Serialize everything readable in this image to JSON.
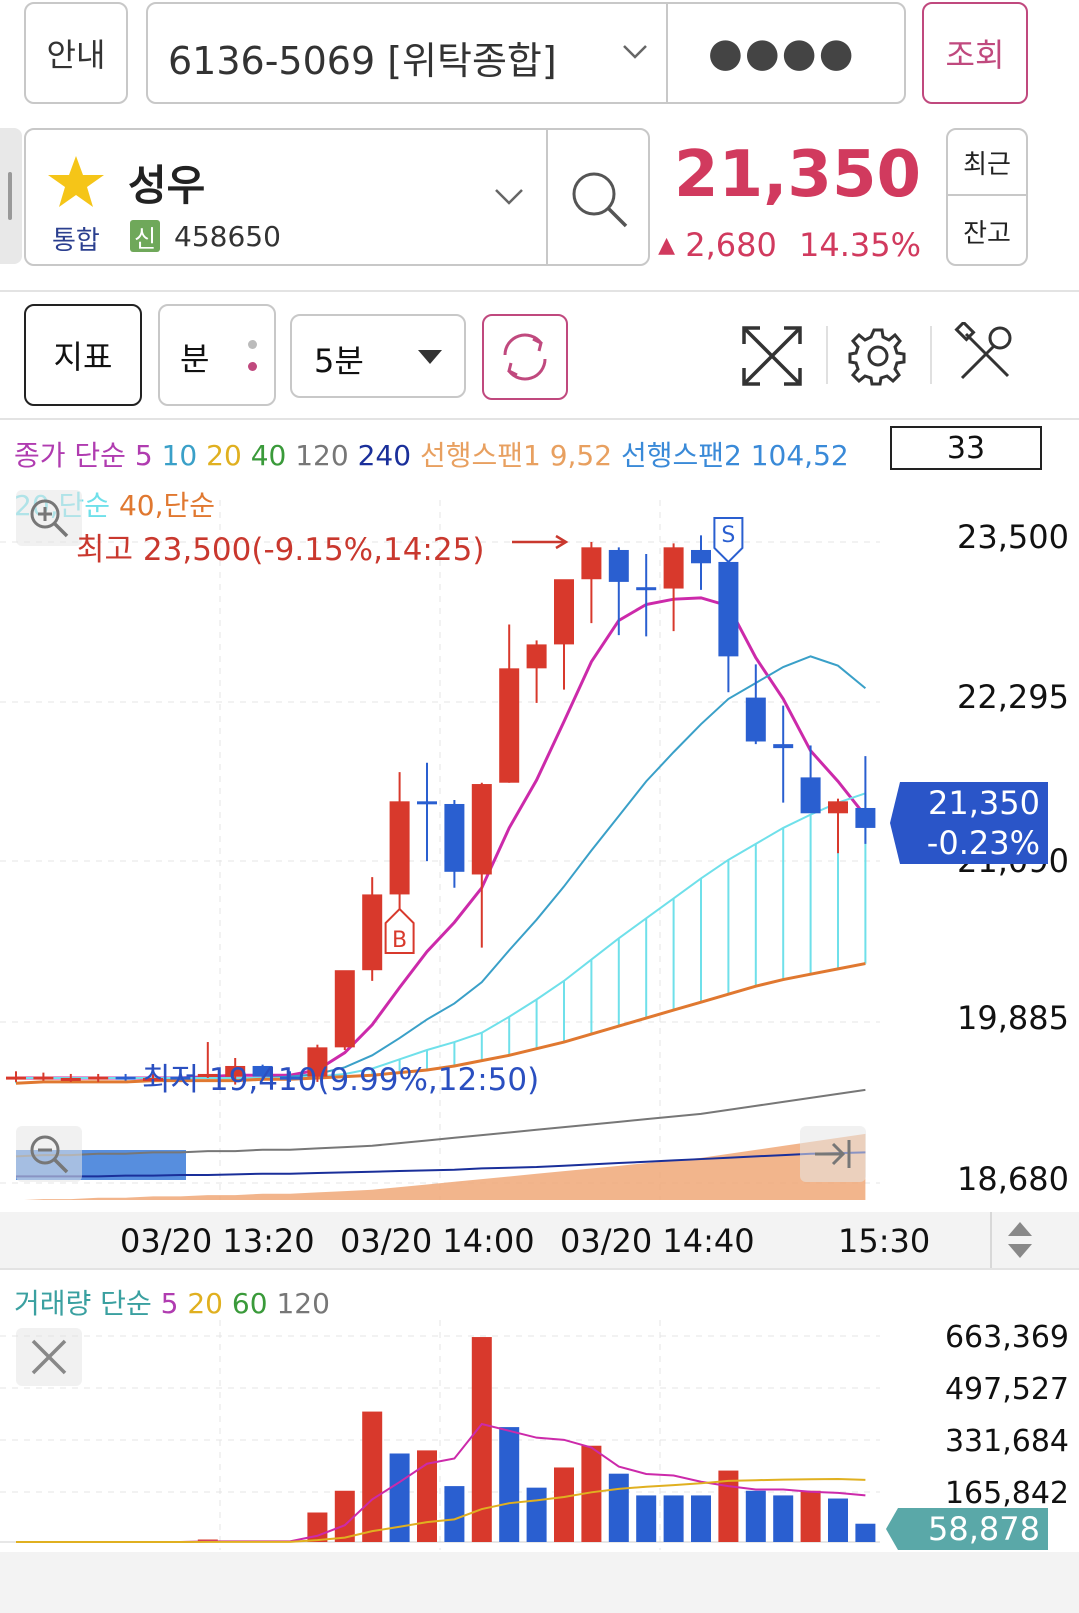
{
  "header": {
    "guide_label": "안내",
    "account_text": "6136-5069 [위탁종합]",
    "password_mask": "●●●●",
    "inquiry_label": "조회"
  },
  "stock": {
    "name": "성우",
    "market": "통합",
    "credit_badge": "신",
    "code": "458650",
    "price": "21,350",
    "change_arrow": "▲",
    "change": "2,680",
    "change_pct": "14.35%",
    "recent_label": "최근",
    "balance_label": "잔고"
  },
  "toolbar": {
    "indicator_label": "지표",
    "period_label": "분",
    "interval_label": "5분"
  },
  "legend": {
    "price_label": "종가 단순",
    "ma5": "5",
    "ma10": "10",
    "ma20": "20",
    "ma40": "40",
    "ma120": "120",
    "ma240": "240",
    "span1": "선행스팬1 9,52",
    "span2": "선행스팬2 104,52",
    "count": "33",
    "line2_a": "20,단순",
    "line2_b": "40,단순"
  },
  "chart_data": [
    {
      "type": "candlestick",
      "annotations": {
        "high": "최고 23,500(-9.15%,14:25)",
        "low": "최저 19,410(9.99%,12:50)",
        "buy_marker": "B",
        "sell_marker": "S"
      },
      "y_ticks": [
        "23,500",
        "22,295",
        "19,885",
        "18,680"
      ],
      "hidden_tick": "21,090",
      "x_ticks": [
        "03/20 13:20",
        "03/20 14:00",
        "03/20 14:40",
        "15:30"
      ],
      "last_price": "21,350",
      "last_change": "-0.23%",
      "ylim": [
        18680,
        23500
      ],
      "candles": [
        {
          "o": 19480,
          "h": 19520,
          "l": 19440,
          "c": 19480
        },
        {
          "o": 19470,
          "h": 19510,
          "l": 19450,
          "c": 19480
        },
        {
          "o": 19470,
          "h": 19500,
          "l": 19440,
          "c": 19470
        },
        {
          "o": 19470,
          "h": 19500,
          "l": 19440,
          "c": 19480
        },
        {
          "o": 19480,
          "h": 19500,
          "l": 19450,
          "c": 19470
        },
        {
          "o": 19470,
          "h": 19500,
          "l": 19440,
          "c": 19470
        },
        {
          "o": 19480,
          "h": 19500,
          "l": 19450,
          "c": 19470
        },
        {
          "o": 19480,
          "h": 19740,
          "l": 19470,
          "c": 19500
        },
        {
          "o": 19480,
          "h": 19620,
          "l": 19420,
          "c": 19560
        },
        {
          "o": 19560,
          "h": 19570,
          "l": 19460,
          "c": 19480
        },
        {
          "o": 19480,
          "h": 19520,
          "l": 19440,
          "c": 19470
        },
        {
          "o": 19480,
          "h": 19720,
          "l": 19440,
          "c": 19700
        },
        {
          "o": 19700,
          "h": 20250,
          "l": 19680,
          "c": 20280
        },
        {
          "o": 20280,
          "h": 20980,
          "l": 20200,
          "c": 20850
        },
        {
          "o": 20850,
          "h": 21770,
          "l": 20740,
          "c": 21550
        },
        {
          "o": 21550,
          "h": 21840,
          "l": 21100,
          "c": 21540
        },
        {
          "o": 21530,
          "h": 21560,
          "l": 20900,
          "c": 21020
        },
        {
          "o": 21000,
          "h": 21690,
          "l": 20450,
          "c": 21680
        },
        {
          "o": 21690,
          "h": 22880,
          "l": 21690,
          "c": 22550
        },
        {
          "o": 22550,
          "h": 22760,
          "l": 22290,
          "c": 22730
        },
        {
          "o": 22730,
          "h": 23180,
          "l": 22390,
          "c": 23220
        },
        {
          "o": 23220,
          "h": 23500,
          "l": 22890,
          "c": 23460
        },
        {
          "o": 23440,
          "h": 23460,
          "l": 22800,
          "c": 23200
        },
        {
          "o": 23160,
          "h": 23410,
          "l": 22790,
          "c": 23140
        },
        {
          "o": 23150,
          "h": 23490,
          "l": 22830,
          "c": 23460
        },
        {
          "o": 23440,
          "h": 23550,
          "l": 23140,
          "c": 23340
        },
        {
          "o": 23350,
          "h": 23390,
          "l": 22370,
          "c": 22640
        },
        {
          "o": 22330,
          "h": 22580,
          "l": 21980,
          "c": 22000
        },
        {
          "o": 21980,
          "h": 22270,
          "l": 21540,
          "c": 21950
        },
        {
          "o": 21730,
          "h": 21970,
          "l": 21510,
          "c": 21460
        },
        {
          "o": 21460,
          "h": 21570,
          "l": 21160,
          "c": 21550
        },
        {
          "o": 21500,
          "h": 21890,
          "l": 21230,
          "c": 21350
        }
      ],
      "series": [
        {
          "name": "5",
          "color": "#cc2aaa",
          "values": [
            19470,
            19470,
            19470,
            19470,
            19470,
            19470,
            19470,
            19480,
            19490,
            19490,
            19490,
            19530,
            19660,
            19870,
            20150,
            20420,
            20640,
            20900,
            21350,
            21710,
            22150,
            22600,
            22910,
            23030,
            23070,
            23080,
            23020,
            22630,
            22320,
            21930,
            21700,
            21440
          ]
        },
        {
          "name": "10",
          "color": "#3aa0c8",
          "values": [
            19470,
            19470,
            19470,
            19470,
            19470,
            19470,
            19470,
            19470,
            19470,
            19470,
            19480,
            19500,
            19550,
            19640,
            19770,
            19910,
            20030,
            20190,
            20430,
            20660,
            20910,
            21180,
            21440,
            21700,
            21920,
            22130,
            22320,
            22440,
            22560,
            22640,
            22570,
            22400
          ]
        },
        {
          "name": "20",
          "color": "#6fe0ea",
          "values": [
            19470,
            19470,
            19470,
            19470,
            19470,
            19470,
            19470,
            19470,
            19470,
            19470,
            19470,
            19480,
            19500,
            19540,
            19610,
            19680,
            19740,
            19810,
            19930,
            20060,
            20200,
            20360,
            20520,
            20670,
            20820,
            20970,
            21110,
            21230,
            21350,
            21450,
            21540,
            21610
          ]
        },
        {
          "name": "40",
          "color": "#e07830",
          "values": [
            19430,
            19440,
            19440,
            19440,
            19440,
            19450,
            19450,
            19450,
            19450,
            19460,
            19460,
            19470,
            19480,
            19490,
            19510,
            19530,
            19560,
            19600,
            19640,
            19690,
            19740,
            19800,
            19860,
            19920,
            19980,
            20040,
            20100,
            20160,
            20210,
            20250,
            20290,
            20330
          ]
        },
        {
          "name": "120",
          "color": "#777777",
          "values": [
            18880,
            18890,
            18890,
            18900,
            18900,
            18910,
            18910,
            18920,
            18920,
            18930,
            18930,
            18940,
            18950,
            18960,
            18980,
            19000,
            19020,
            19040,
            19060,
            19080,
            19100,
            19120,
            19140,
            19160,
            19180,
            19200,
            19230,
            19260,
            19290,
            19320,
            19350,
            19380
          ]
        },
        {
          "name": "240",
          "color": "#1a2f9a",
          "values": [
            18730,
            18730,
            18730,
            18730,
            18735,
            18735,
            18740,
            18740,
            18745,
            18750,
            18750,
            18755,
            18760,
            18765,
            18770,
            18775,
            18780,
            18790,
            18795,
            18800,
            18810,
            18820,
            18830,
            18840,
            18850,
            18860,
            18870,
            18880,
            18890,
            18900,
            18905,
            18910
          ]
        }
      ]
    },
    {
      "type": "bar",
      "title": "거래량 단순",
      "legend": [
        "5",
        "20",
        "60",
        "120"
      ],
      "y_ticks": [
        "663,369",
        "497,527",
        "331,684",
        "165,842"
      ],
      "last_volume": "58,878",
      "ylim": [
        0,
        663369
      ],
      "values": [
        0,
        0,
        0,
        0,
        0,
        0,
        0,
        8000,
        0,
        0,
        0,
        95000,
        165000,
        420000,
        285000,
        295000,
        180000,
        660000,
        370000,
        175000,
        240000,
        310000,
        220000,
        150000,
        150000,
        150000,
        230000,
        165000,
        150000,
        165000,
        140000,
        58878
      ],
      "up": [
        0,
        0,
        0,
        0,
        0,
        0,
        0,
        1,
        0,
        0,
        0,
        1,
        1,
        1,
        0,
        1,
        0,
        1,
        0,
        0,
        1,
        1,
        0,
        0,
        0,
        0,
        1,
        0,
        0,
        1,
        0,
        0
      ],
      "ma5": [
        0,
        0,
        0,
        0,
        0,
        0,
        0,
        2000,
        2000,
        2000,
        2000,
        20000,
        54000,
        137000,
        193000,
        252000,
        269000,
        380000,
        358000,
        336000,
        329000,
        304000,
        243000,
        219000,
        214000,
        194000,
        180000,
        169000,
        169000,
        162000,
        158000,
        150000
      ],
      "ma20": [
        0,
        0,
        0,
        0,
        0,
        0,
        0,
        500,
        500,
        500,
        500,
        6000,
        14000,
        35000,
        49000,
        64000,
        73000,
        106000,
        125000,
        134000,
        145000,
        160000,
        171000,
        178000,
        183000,
        189000,
        197000,
        199000,
        201000,
        202000,
        203000,
        200000
      ]
    }
  ]
}
